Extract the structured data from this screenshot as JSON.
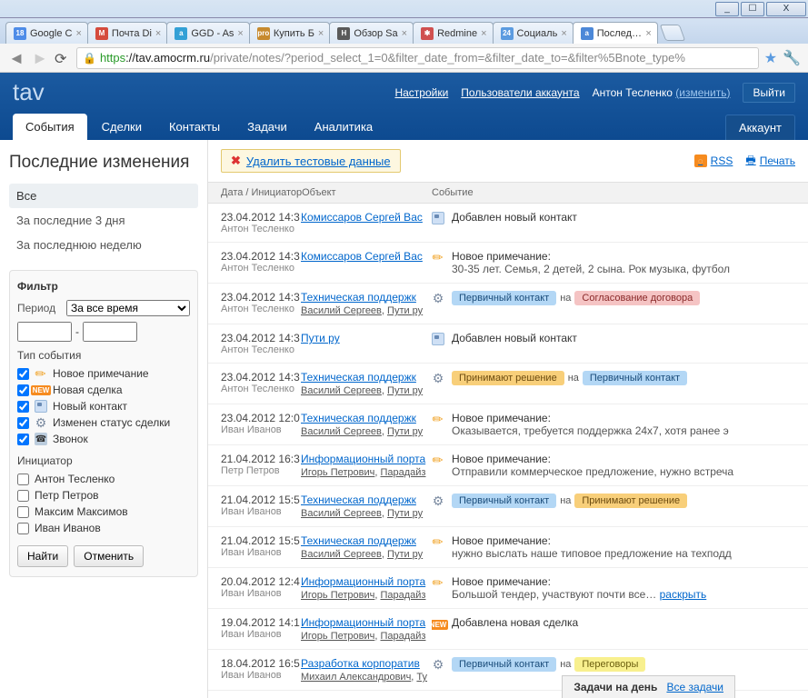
{
  "window": {
    "min": "_",
    "max": "☐",
    "close": "X"
  },
  "browser_tabs": [
    {
      "label": "Google C",
      "favcolor": "#4e8ce8",
      "badge": "18"
    },
    {
      "label": "Почта Di",
      "favcolor": "#d54b3d",
      "glyph": "M"
    },
    {
      "label": "GGD - As",
      "favcolor": "#33a0d6",
      "glyph": "a"
    },
    {
      "label": "Купить Б",
      "favcolor": "#c78a2e",
      "glyph": "pro"
    },
    {
      "label": "Обзор Sa",
      "favcolor": "#5a5a5a",
      "glyph": "H"
    },
    {
      "label": "Redmine",
      "favcolor": "#d05050",
      "glyph": "✱"
    },
    {
      "label": "Социаль",
      "favcolor": "#5b9be0",
      "glyph": "24"
    },
    {
      "label": "Последни",
      "favcolor": "#4c88d8",
      "glyph": "a",
      "active": true
    }
  ],
  "url": {
    "https": "https",
    "host": "://tav.amocrm.ru",
    "path": "/private/notes/?period_select_1=0&filter_date_from=&filter_date_to=&filter%5Bnote_type%"
  },
  "header": {
    "logo": "tav",
    "links": {
      "settings": "Настройки",
      "users": "Пользователи аккаунта",
      "me": "Антон Тесленко",
      "edit": "(изменить)",
      "logout": "Выйти"
    }
  },
  "nav": {
    "tabs": [
      "События",
      "Сделки",
      "Контакты",
      "Задачи",
      "Аналитика"
    ],
    "account": "Аккаунт"
  },
  "page": {
    "title": "Последние изменения",
    "quick_filter": [
      "Все",
      "За последние 3 дня",
      "За последнюю неделю"
    ],
    "delete_banner": "Удалить тестовые данные",
    "rss": "RSS",
    "print": "Печать",
    "columns": {
      "c1": "Дата / ИнициаторОбъект",
      "c2": "Событие"
    }
  },
  "filter": {
    "title": "Фильтр",
    "period_label": "Период",
    "period_value": "За все время",
    "event_type_label": "Тип события",
    "types": [
      {
        "label": "Новое примечание",
        "checked": true,
        "icon": "pencil"
      },
      {
        "label": "Новая сделка",
        "checked": true,
        "icon": "new"
      },
      {
        "label": "Новый контакт",
        "checked": true,
        "icon": "card"
      },
      {
        "label": "Изменен статус сделки",
        "checked": true,
        "icon": "gear"
      },
      {
        "label": "Звонок",
        "checked": true,
        "icon": "phone"
      }
    ],
    "initiator_label": "Инициатор",
    "initiators": [
      "Антон Тесленко",
      "Петр Петров",
      "Максим Максимов",
      "Иван Иванов"
    ],
    "find": "Найти",
    "cancel": "Отменить"
  },
  "events": [
    {
      "dt": "23.04.2012 14:3",
      "init": "Антон Тесленко",
      "obj": "Комиссаров Сергей Вас",
      "icon": "card",
      "text": "Добавлен новый контакт"
    },
    {
      "dt": "23.04.2012 14:3",
      "init": "Антон Тесленко",
      "obj": "Комиссаров Сергей Вас",
      "icon": "pencil",
      "text": "Новое примечание:",
      "sub": "30-35 лет. Семья, 2 детей, 2 сына. Рок музыка, футбол"
    },
    {
      "dt": "23.04.2012 14:3",
      "init": "Антон Тесленко",
      "obj": "Техническая поддержк",
      "obj_sub": "Василий Сергеев, Пути ру",
      "icon": "gear",
      "tag_from": {
        "text": "Первичный контакт",
        "cls": "blue"
      },
      "sep": "на",
      "tag_to": {
        "text": "Согласование договора",
        "cls": "red"
      }
    },
    {
      "dt": "23.04.2012 14:3",
      "init": "Антон Тесленко",
      "obj": "Пути ру",
      "icon": "card",
      "text": "Добавлен новый контакт"
    },
    {
      "dt": "23.04.2012 14:3",
      "init": "Антон Тесленко",
      "obj": "Техническая поддержк",
      "obj_sub": "Василий Сергеев, Пути ру",
      "icon": "gear",
      "tag_from": {
        "text": "Принимают решение",
        "cls": "orange"
      },
      "sep": "на",
      "tag_to": {
        "text": "Первичный контакт",
        "cls": "blue"
      }
    },
    {
      "dt": "23.04.2012 12:0",
      "init": "Иван Иванов",
      "obj": "Техническая поддержк",
      "obj_sub": "Василий Сергеев, Пути ру",
      "icon": "pencil",
      "text": "Новое примечание:",
      "sub": "Оказывается, требуется поддержка 24x7, хотя ранее э"
    },
    {
      "dt": "21.04.2012 16:3",
      "init": "Петр Петров",
      "obj": "Информационный порта",
      "obj_sub": "Игорь Петрович, Парадайз",
      "icon": "pencil",
      "text": "Новое примечание:",
      "sub": "Отправили коммерческое предложение, нужно встреча"
    },
    {
      "dt": "21.04.2012 15:5",
      "init": "Иван Иванов",
      "obj": "Техническая поддержк",
      "obj_sub": "Василий Сергеев, Пути ру",
      "icon": "gear",
      "tag_from": {
        "text": "Первичный контакт",
        "cls": "blue"
      },
      "sep": "на",
      "tag_to": {
        "text": "Принимают решение",
        "cls": "orange"
      }
    },
    {
      "dt": "21.04.2012 15:5",
      "init": "Иван Иванов",
      "obj": "Техническая поддержк",
      "obj_sub": "Василий Сергеев, Пути ру",
      "icon": "pencil",
      "text": "Новое примечание:",
      "sub": "нужно выслать наше типовое предложение на техподд"
    },
    {
      "dt": "20.04.2012 12:4",
      "init": "Иван Иванов",
      "obj": "Информационный порта",
      "obj_sub": "Игорь Петрович, Парадайз",
      "icon": "pencil",
      "text": "Новое примечание:",
      "sub": "Большой тендер, участвуют почти все…",
      "reveal": "раскрыть"
    },
    {
      "dt": "19.04.2012 14:1",
      "init": "Иван Иванов",
      "obj": "Информационный порта",
      "obj_sub": "Игорь Петрович, Парадайз",
      "icon": "new",
      "text": "Добавлена новая сделка"
    },
    {
      "dt": "18.04.2012 16:5",
      "init": "Иван Иванов",
      "obj": "Разработка корпоратив",
      "obj_sub": "Михаил Александрович, Ту",
      "icon": "gear",
      "tag_from": {
        "text": "Первичный контакт",
        "cls": "blue"
      },
      "sep": "на",
      "tag_to": {
        "text": "Переговоры",
        "cls": "yellow"
      }
    }
  ],
  "footer": {
    "title": "Задачи на день",
    "link": "Все задачи"
  }
}
